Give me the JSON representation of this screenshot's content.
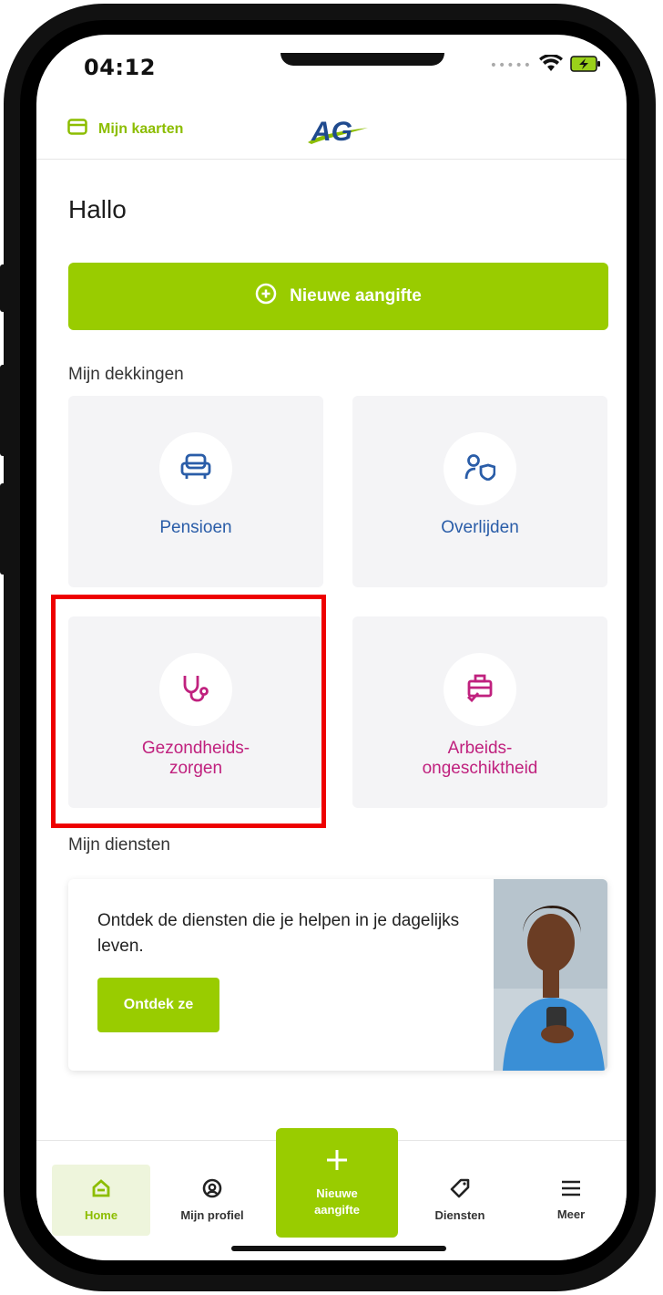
{
  "status_bar": {
    "time": "04:12"
  },
  "header": {
    "cards_link_label": "Mijn kaarten",
    "logo_text": "AG"
  },
  "greeting": "Hallo",
  "new_claim_button": "Nieuwe aangifte",
  "coverages": {
    "title": "Mijn dekkingen",
    "tiles": [
      {
        "label": "Pensioen",
        "icon": "armchair-icon",
        "color": "#2a5da8"
      },
      {
        "label": "Overlijden",
        "icon": "person-shield-icon",
        "color": "#2a5da8"
      },
      {
        "label": "Gezondheids-\nzorgen",
        "icon": "stethoscope-icon",
        "color": "#c0217e"
      },
      {
        "label": "Arbeids-\nongeschiktheid",
        "icon": "briefcase-check-icon",
        "color": "#c0217e"
      }
    ]
  },
  "services": {
    "title": "Mijn diensten",
    "text": "Ontdek de diensten die je helpen in je dagelijks leven.",
    "button": "Ontdek ze"
  },
  "bottom_nav": {
    "items": [
      {
        "label": "Home",
        "icon": "home-icon",
        "active": true
      },
      {
        "label": "Mijn profiel",
        "icon": "profile-icon"
      },
      {
        "label": "Nieuwe\naangifte",
        "icon": "plus-icon"
      },
      {
        "label": "Diensten",
        "icon": "tag-icon"
      },
      {
        "label": "Meer",
        "icon": "menu-icon"
      }
    ]
  },
  "colors": {
    "brand_green": "#99cc00",
    "link_green": "#8cbd00",
    "coverage_blue": "#2a5da8",
    "health_pink": "#c0217e",
    "highlight_red": "#ee0000"
  }
}
